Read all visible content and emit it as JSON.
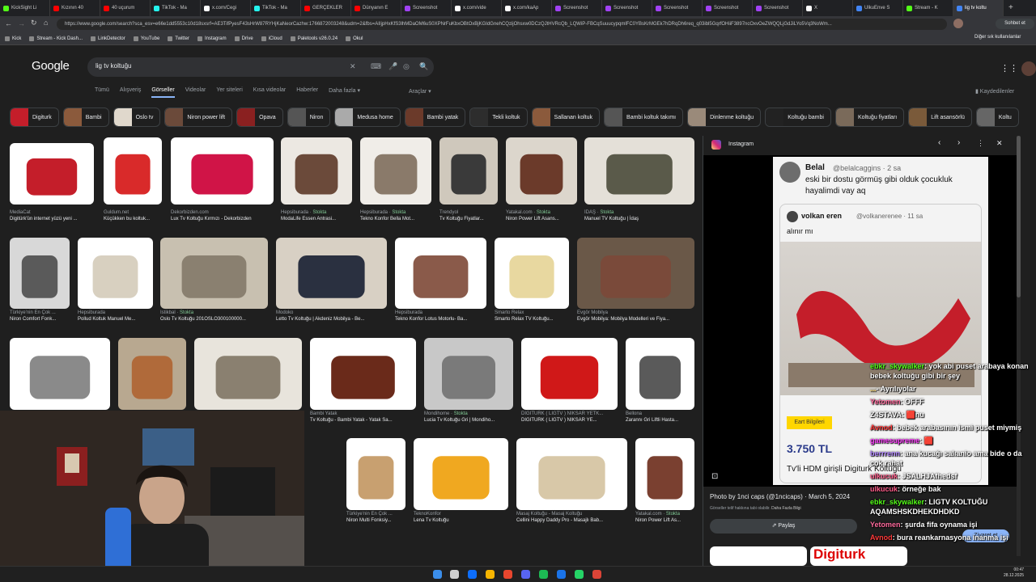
{
  "tabs": [
    {
      "label": "KickSight Li",
      "color": "#53fc18"
    },
    {
      "label": "Kızının 40 ",
      "color": "#ff0000"
    },
    {
      "label": "40 uçurum",
      "color": "#ff0000"
    },
    {
      "label": "TikTok - Ma",
      "color": "#25f4ee"
    },
    {
      "label": "x.com/Cegi",
      "color": "#ffffff"
    },
    {
      "label": "TikTok - Ma",
      "color": "#25f4ee"
    },
    {
      "label": "GERÇEKLER",
      "color": "#ff0000"
    },
    {
      "label": "Dünyanın E",
      "color": "#ff0000"
    },
    {
      "label": "Screenshot",
      "color": "#a142f4"
    },
    {
      "label": "x.com/vide",
      "color": "#ffffff"
    },
    {
      "label": "x.com/kaAp",
      "color": "#ffffff"
    },
    {
      "label": "Screenshot",
      "color": "#a142f4"
    },
    {
      "label": "Screenshot",
      "color": "#a142f4"
    },
    {
      "label": "Screenshot",
      "color": "#a142f4"
    },
    {
      "label": "Screenshot",
      "color": "#a142f4"
    },
    {
      "label": "Screenshot",
      "color": "#a142f4"
    },
    {
      "label": "X",
      "color": "#ffffff"
    },
    {
      "label": "UlkuEnve S",
      "color": "#4285f4"
    },
    {
      "label": "Stream - K",
      "color": "#53fc18"
    },
    {
      "label": "lig tv koltu",
      "color": "#4285f4",
      "active": true
    }
  ],
  "browser": {
    "url": "https://www.google.com/search?sca_esv=e66e1dd5553c10d18sxsrf=AE3TifPyesF43sHrW87RYHjKaNeorCazhw:1766872003248&udm=2&fbs=AIIjpHxKfS3lhMDaOM6uS0XPNrFuKbxOBtOxBjKGIdGnehCQzijOhsxw0DCzQJtHVRcQb_LQWiP-FBCqSuuucypqmlFC0YBsKrMGEk7hDRqDh6req_q03ibl5GqrfOHiiF3897ncOxvOeZWQQLjGdJiLYo5Vq3NoWm...",
    "profile_label": "Sohbet et",
    "other_bookmarks": "Diğer sık kullanılanlar"
  },
  "bookmarks": [
    "Kick",
    "Stream - Kick Dash...",
    "LinkDetector",
    "YouTube",
    "Twitter",
    "Instagram",
    "Drive",
    "iCloud",
    "Paletools v26.0.24",
    "Okul"
  ],
  "google": {
    "logo": "Google",
    "query": "lig tv koltuğu",
    "nav": [
      "Tümü",
      "Alışveriş",
      "Görseller",
      "Videolar",
      "Yer siteleri",
      "Kısa videolar",
      "Haberler",
      "Daha fazla ▾"
    ],
    "tools": "Araçlar ▾",
    "saved": "Kaydedilenler",
    "chips": [
      "Digiturk",
      "Bambi",
      "Oslo tv",
      "Niron power lift",
      "Opava",
      "Niron",
      "Medusa home",
      "Bambi yatak",
      "Tekli koltuk",
      "Sallanan koltuk",
      "Bambi koltuk takımı",
      "Dinlenme koltuğu",
      "Koltuğu bambi",
      "Koltuğu fiyatları",
      "Lift asansörlü",
      "Koltu"
    ]
  },
  "results": [
    {
      "source": "MediaCat",
      "title": "Digitürk'ün internet yüzü yeni ...",
      "stock": ""
    },
    {
      "source": "Guldum.net",
      "title": "Küçükken bu koltuk...",
      "stock": ""
    },
    {
      "source": "Dekorbizden.com",
      "title": "Lux Tv Koltuğu Kırmızı - Dekorbizden",
      "stock": ""
    },
    {
      "source": "Hepsiburada",
      "title": "ModaLife Essen Antrasi...",
      "stock": "Stokta"
    },
    {
      "source": "Hepsiburada",
      "title": "Tekno Konfor Bella Mot...",
      "stock": "Stokta"
    },
    {
      "source": "Trendyol",
      "title": "Tv Koltuğu Fiyatlar...",
      "stock": ""
    },
    {
      "source": "Yatakal.com",
      "title": "Niron Power Lift Asans...",
      "stock": "Stokta"
    },
    {
      "source": "İDAŞ",
      "title": "Manuel TV Koltuğu | İdaş",
      "stock": "Stokta"
    },
    {
      "source": "Türkiye'nin En Çok ...",
      "title": "Niron Comfort Fonk...",
      "stock": ""
    },
    {
      "source": "Hepsiburada",
      "title": "Pollud Koltuk Manuel Me...",
      "stock": ""
    },
    {
      "source": "Istikbal",
      "title": "Oslo Tv Koltuğu 201OSLO300100000...",
      "stock": "Stokta"
    },
    {
      "source": "Modoko",
      "title": "Letto Tv Koltuğu | Akdeniz Mobilya - Be...",
      "stock": ""
    },
    {
      "source": "Hepsiburada",
      "title": "Tekno Konfor Lotus Motorlu- Ba...",
      "stock": ""
    },
    {
      "source": "Smarto Relax",
      "title": "Smarto Relax TV Koltuğu...",
      "stock": ""
    },
    {
      "source": "Evgör Mobilya",
      "title": "Evgör Mobilya: Mobilya Modelleri ve Fiya...",
      "stock": ""
    },
    {
      "source": "Bambi Yatak",
      "title": "Tv Koltuğu - Bambi Yatak - Yatak Sa...",
      "stock": ""
    },
    {
      "source": "Mondihome",
      "title": "Lucia Tv Koltuğu Gri | Mondiho...",
      "stock": "Stokta"
    },
    {
      "source": "DIGITURK ( LIGTV ) NIKSAR YETK...",
      "title": "DIGITURK ( LIGTV ) NIKSAR YE...",
      "stock": ""
    },
    {
      "source": "Bellona",
      "title": "Zarannı Gri Liftli Hasta...",
      "stock": ""
    },
    {
      "source": "Türkiye'nin En Çok ...",
      "title": "Niron Multi Fonksiy...",
      "stock": ""
    },
    {
      "source": "TeknoKonfor",
      "title": "Lena Tv Koltuğu",
      "stock": ""
    },
    {
      "source": "Masaj Koltuğu - Masaj Koltuğu",
      "title": "Cellini Happy Daddy Pro - Masajlı Bab...",
      "stock": ""
    },
    {
      "source": "Yatakal.com",
      "title": "Niron Power Lift As...",
      "stock": "Stokta"
    }
  ],
  "panel": {
    "source": "Instagram",
    "tweet_user": "Belal",
    "tweet_handle": "@belalcaggins · 2 sa",
    "tweet_text": "eski bir dostu görmüş gibi olduk çocukluk hayalimdi vay aq",
    "quoted_user": "volkan eren",
    "quoted_handle": "@volkanerenee · 11 sa",
    "quoted_text": "alınır mı",
    "price": "3.750 TL",
    "price_note": "Tv'li HDM girişli Digiturk Koltuğu",
    "photo_by": "Photo by 1nci caps (@1ncicaps) · March 5, 2024",
    "copyright": "Görseller telif hakkına tabi olabilir.",
    "learn_more": "Daha Fazla Bilgi",
    "share": "Paylaş",
    "visit": "Ziyaret et",
    "related_text": "Digiturk"
  },
  "chat": [
    {
      "user": "ebkr_skywalker",
      "color": "#53fc18",
      "msg": ": yok abi puset arabaya konan bebek koltuğu gibi bir şey"
    },
    {
      "user": "...",
      "color": "#ffd54f",
      "msg": "- Ayrılıyolar"
    },
    {
      "user": "Yetomen",
      "color": "#ff6b9d",
      "msg": ": OFFF"
    },
    {
      "user": "Z4STAVA",
      "color": "#ffffff",
      "msg": ": 🟥nu"
    },
    {
      "user": "Avnod",
      "color": "#ff3b3b",
      "msg": ": bebek arabasının ismi puset miymiş"
    },
    {
      "user": "gamesupreme",
      "color": "#ff3bff",
      "msg": ": 🟥"
    },
    {
      "user": "berrrenn",
      "color": "#b388ff",
      "msg": ": ana kucağı salıanio ama bide o da cok rahat"
    },
    {
      "user": "ulkucuk",
      "color": "#ff5c8a",
      "msg": ": JSALHJAfhedsf"
    },
    {
      "user": "ulkucuk",
      "color": "#ff5c8a",
      "msg": ": örneğe bak"
    },
    {
      "user": "ebkr_skywalker",
      "color": "#53fc18",
      "msg": ": LIGTV KOLTUĞU AQAMSHSKDHEKDHDKD"
    },
    {
      "user": "Yetomen",
      "color": "#ff6b9d",
      "msg": ": şurda fifa oynama işi"
    },
    {
      "user": "Avnod",
      "color": "#ff3b3b",
      "msg": ": bura reankarnasyona inanma işi"
    }
  ],
  "taskbar": {
    "time": "00:47",
    "date": "28.12.2025"
  }
}
